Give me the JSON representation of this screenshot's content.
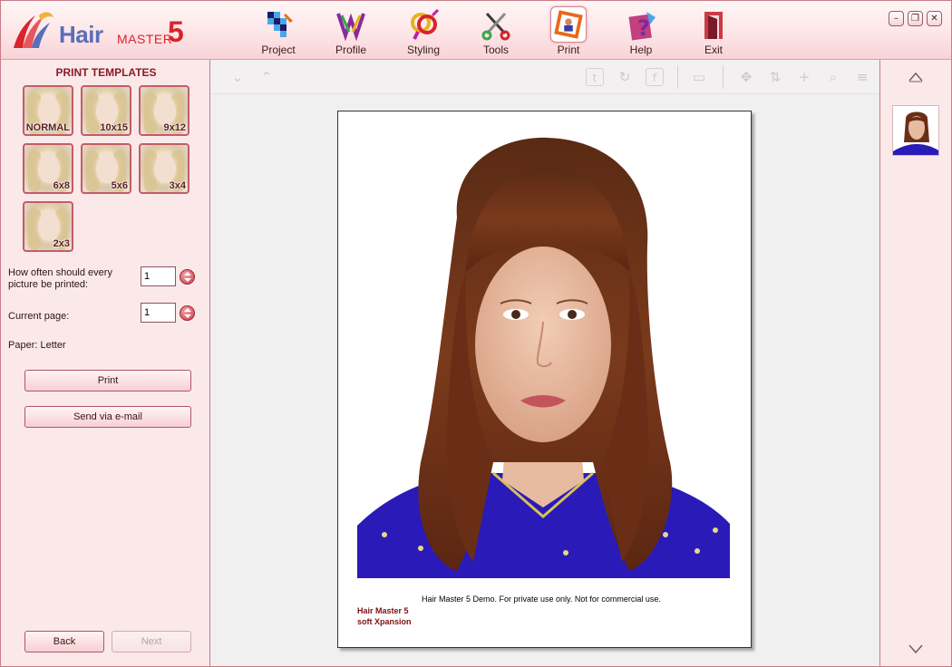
{
  "app": {
    "logo_hair": "Hair",
    "logo_master": "MASTER",
    "logo_five": "5"
  },
  "menu": [
    {
      "label": "Project",
      "icon": "project-icon"
    },
    {
      "label": "Profile",
      "icon": "profile-icon"
    },
    {
      "label": "Styling",
      "icon": "styling-icon"
    },
    {
      "label": "Tools",
      "icon": "tools-icon"
    },
    {
      "label": "Print",
      "icon": "print-icon",
      "active": true
    },
    {
      "label": "Help",
      "icon": "help-icon"
    },
    {
      "label": "Exit",
      "icon": "exit-icon"
    }
  ],
  "window_controls": {
    "minimize": "–",
    "restore": "❐",
    "close": "✕"
  },
  "left_panel": {
    "title": "PRINT TEMPLATES",
    "templates": [
      "NORMAL",
      "10x15",
      "9x12",
      "6x8",
      "5x6",
      "3x4",
      "2x3"
    ],
    "copies_label": "How often should every picture be printed:",
    "copies_value": "1",
    "page_label": "Current page:",
    "page_value": "1",
    "paper_label": "Paper: Letter",
    "print_button": "Print",
    "email_button": "Send via e-mail",
    "back_button": "Back",
    "next_button": "Next"
  },
  "preview": {
    "watermark": "Hair Master 5 Demo. For private use only. Not for commercial use.",
    "credit_line1": "Hair Master 5",
    "credit_line2": "soft Xpansion"
  },
  "colors": {
    "accent": "#c45c67",
    "panel_bg": "#fbe9ea",
    "brand_red": "#d8242c",
    "brand_blue": "#5a6fb8"
  }
}
